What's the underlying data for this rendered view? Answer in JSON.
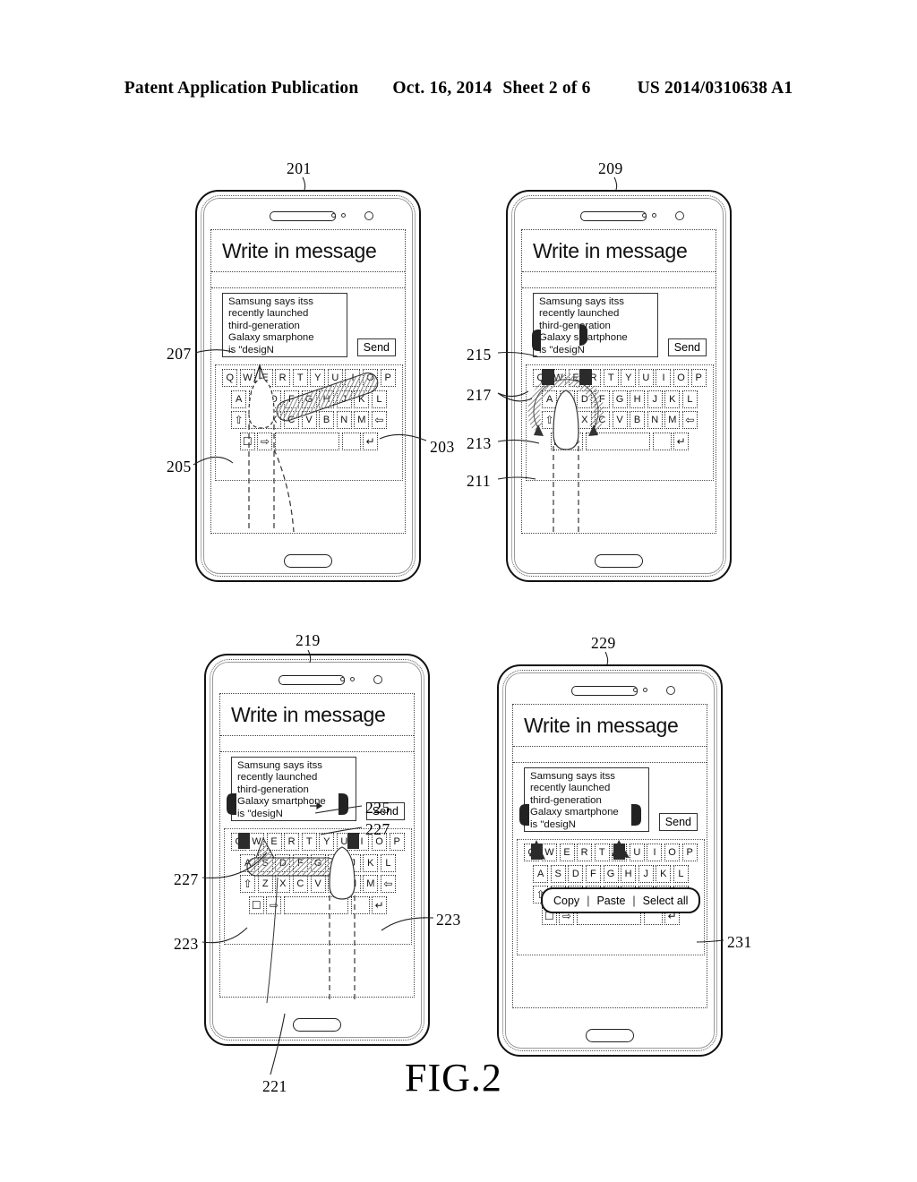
{
  "header": {
    "publication": "Patent Application Publication",
    "date": "Oct. 16, 2014",
    "sheet": "Sheet 2 of 6",
    "patent_number": "US 2014/0310638 A1"
  },
  "figure": {
    "caption": "FIG.2"
  },
  "screen": {
    "title": "Write in message",
    "send_label": "Send",
    "message_lines": [
      "Samsung says itss",
      "recently launched",
      "third-generation",
      "Galaxy smarphone",
      "is \"desigN"
    ],
    "message_lines_alt": [
      "Samsung says itss",
      "recently launched",
      "third-generation",
      "Galaxy smartphone",
      "is \"desigN"
    ],
    "selected_text": "third-generation"
  },
  "keyboard": {
    "row1": [
      "Q",
      "W",
      "E",
      "R",
      "T",
      "Y",
      "U",
      "I",
      "O",
      "P"
    ],
    "row2": [
      "A",
      "S",
      "D",
      "F",
      "G",
      "H",
      "J",
      "K",
      "L"
    ],
    "row3": [
      "Z",
      "X",
      "C",
      "V",
      "B",
      "N",
      "M"
    ],
    "shift_icon": "⇧",
    "backspace_icon": "⇦",
    "emoji_icon": "☐",
    "settings_icon": "⇨",
    "enter_icon": "↵",
    "space_label": ""
  },
  "context_menu": {
    "items": [
      "Copy",
      "Paste",
      "Select all"
    ],
    "separator": "|"
  },
  "panels": [
    {
      "id": "panel-1",
      "device_ref": "201",
      "refs": [
        "207",
        "205",
        "203"
      ],
      "gesture": "diagonal-swipe"
    },
    {
      "id": "panel-2",
      "device_ref": "209",
      "refs": [
        "215",
        "217",
        "213",
        "211"
      ],
      "gesture": "circular-pinch"
    },
    {
      "id": "panel-3",
      "device_ref": "219",
      "refs": [
        "225",
        "227",
        "223",
        "221"
      ],
      "gesture": "horizontal-drag"
    },
    {
      "id": "panel-4",
      "device_ref": "229",
      "refs": [
        "231"
      ],
      "gesture": "context-menu"
    }
  ],
  "reference_numerals": {
    "n201": "201",
    "n203": "203",
    "n205": "205",
    "n207": "207",
    "n209": "209",
    "n211": "211",
    "n213": "213",
    "n215": "215",
    "n217": "217",
    "n219": "219",
    "n221": "221",
    "n223a": "223",
    "n223b": "223",
    "n225": "225",
    "n227a": "227",
    "n227b": "227",
    "n229": "229",
    "n231": "231"
  },
  "colors": {
    "ink": "#000000",
    "paper": "#ffffff",
    "highlight": "#d8d8d8",
    "hatch": "#9a9a9a"
  }
}
